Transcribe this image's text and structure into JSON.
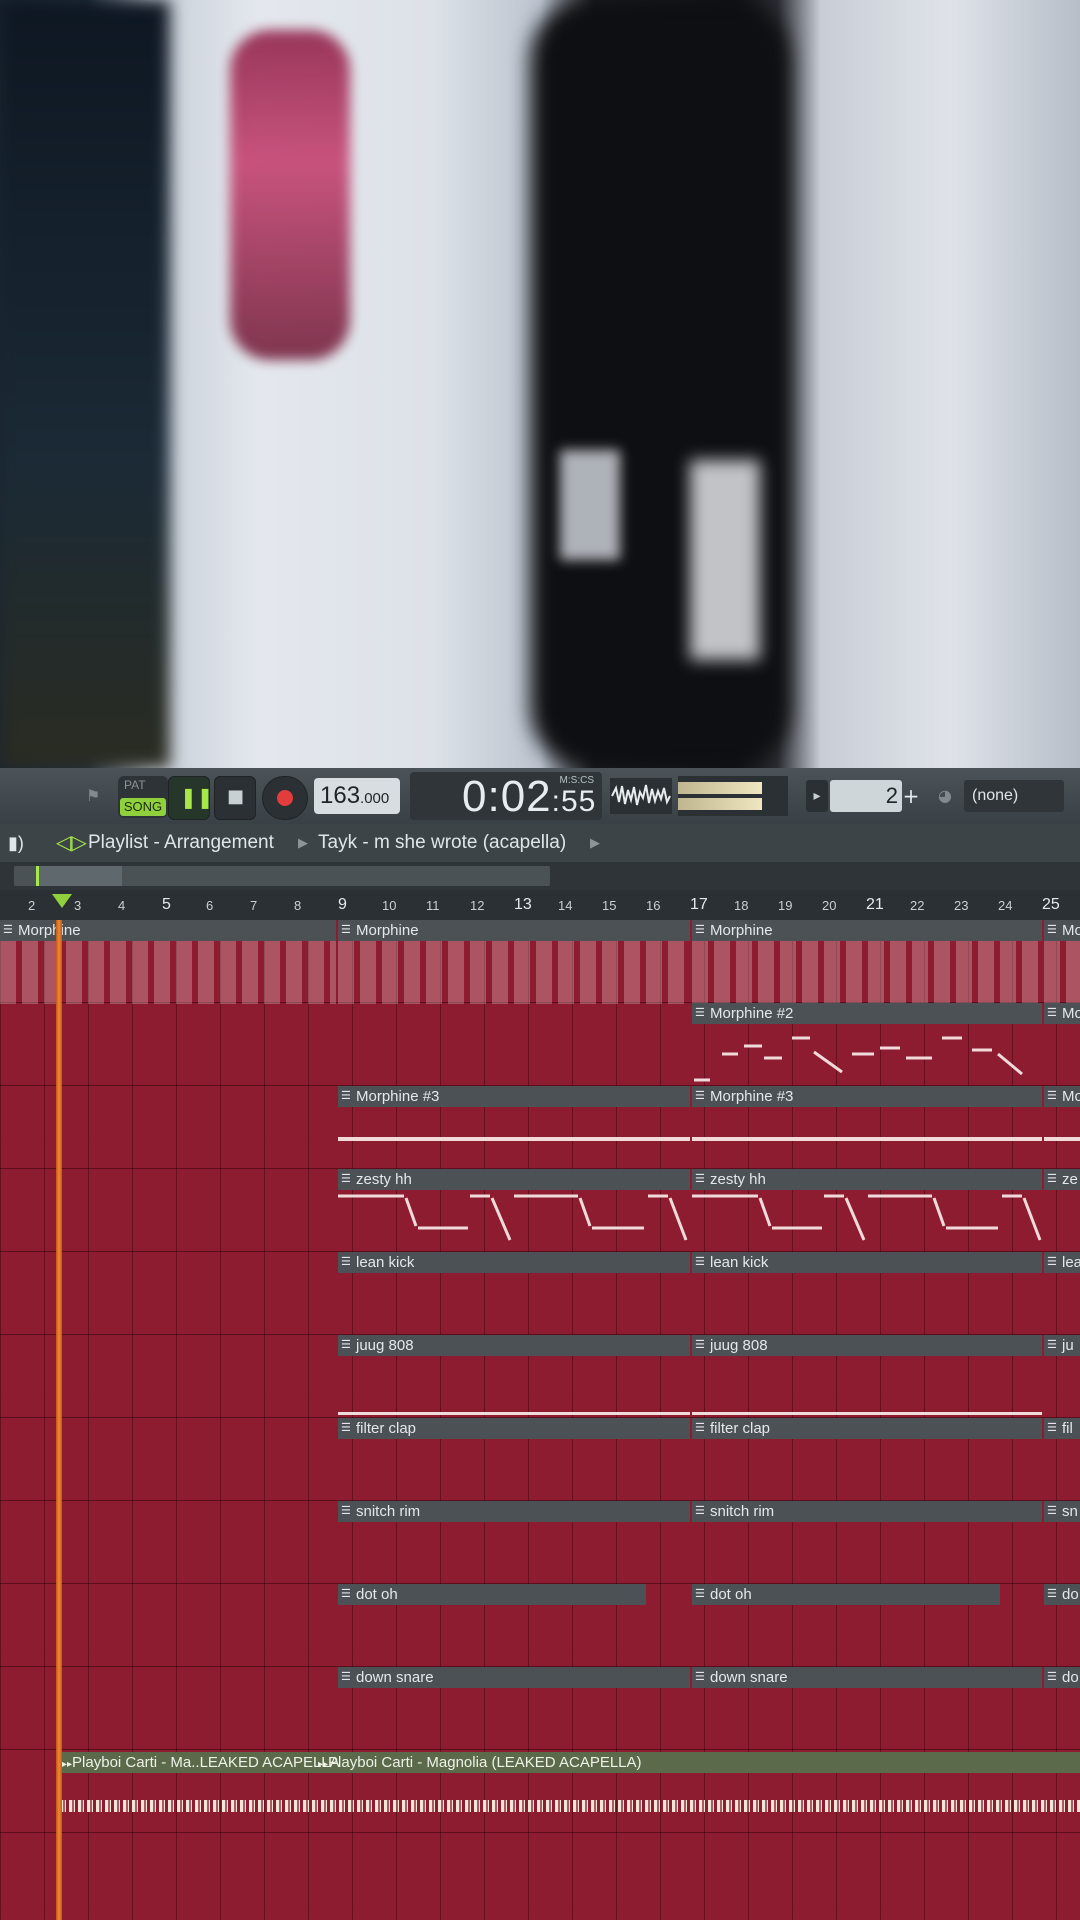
{
  "toolbar": {
    "pat_label": "PAT",
    "song_label": "SONG",
    "tempo_int": "163",
    "tempo_dec": ".000",
    "time_main": "0:02",
    "time_cs": ":55",
    "time_format": "M:S:CS",
    "pattern_number": "2",
    "plus_label": "+",
    "channel_dropdown": "(none)"
  },
  "header": {
    "title": "Playlist - Arrangement",
    "pattern_name": "Tayk - m she wrote (acapella)"
  },
  "ruler": {
    "bars": [
      "2",
      "3",
      "4",
      "5",
      "6",
      "7",
      "8",
      "9",
      "10",
      "11",
      "12",
      "13",
      "14",
      "15",
      "16",
      "17",
      "18",
      "19",
      "20",
      "21",
      "22",
      "23",
      "24",
      "25"
    ]
  },
  "clips": {
    "morphine": "Morphine",
    "morphine2": "Morphine #2",
    "morphine3": "Morphine #3",
    "zesty_hh": "zesty hh",
    "lean_kick": "lean kick",
    "juug_808": "juug 808",
    "filter_clap": "filter clap",
    "snitch_rim": "snitch rim",
    "dot_oh": "dot oh",
    "down_snare": "down snare",
    "mo_trunc": "Mo",
    "ze_trunc": "ze",
    "lea_trunc": "lea",
    "ju_trunc": "ju",
    "fil_trunc": "fil",
    "sn_trunc": "sn",
    "do_trunc": "do"
  },
  "audio": {
    "clip_a": "Playboi Carti - Ma..LEAKED ACAPELLA",
    "clip_b": "Playboi Carti - Magnolia (LEAKED ACAPELLA)"
  }
}
